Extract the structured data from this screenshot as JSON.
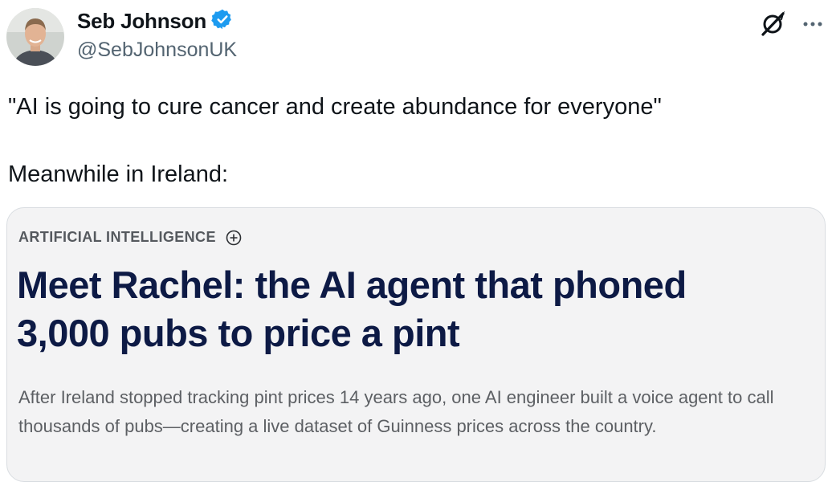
{
  "author": {
    "display_name": "Seb Johnson",
    "handle": "@SebJohnsonUK",
    "verified_color": "#1d9bf0"
  },
  "tweet": {
    "text": "\"AI is going to cure cancer and create abundance for everyone\"\n\nMeanwhile in Ireland:"
  },
  "card": {
    "category": "ARTIFICIAL INTELLIGENCE",
    "headline": "Meet Rachel: the AI agent that phoned 3,000 pubs to price a pint",
    "summary": "After Ireland stopped tracking pint prices 14 years ago, one AI engineer built a voice agent to call thousands of pubs—creating a live dataset of Guinness prices across the country."
  },
  "icons": {
    "verified": "verified-badge-icon",
    "grok": "grok-icon",
    "more": "more-icon",
    "follow_topic": "plus-circle-icon"
  },
  "colors": {
    "headline": "#0d1a45",
    "card_background": "#f3f3f4",
    "handle": "#536471"
  }
}
